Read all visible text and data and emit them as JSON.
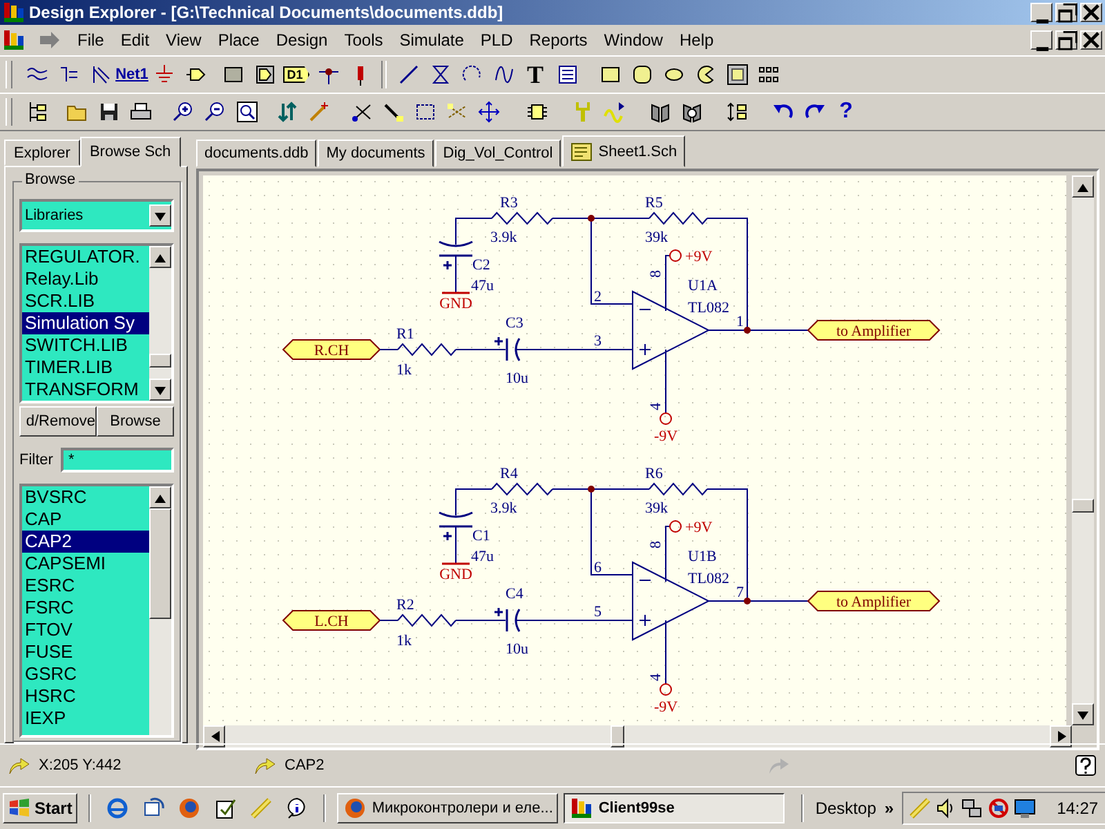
{
  "window": {
    "title": "Design Explorer - [G:\\Technical Documents\\documents.ddb]"
  },
  "menu": [
    {
      "label": "File"
    },
    {
      "label": "Edit"
    },
    {
      "label": "View"
    },
    {
      "label": "Place"
    },
    {
      "label": "Design"
    },
    {
      "label": "Tools"
    },
    {
      "label": "Simulate"
    },
    {
      "label": "PLD"
    },
    {
      "label": "Reports"
    },
    {
      "label": "Window"
    },
    {
      "label": "Help"
    }
  ],
  "toolbar_texts": {
    "net_label": "Net1",
    "part_port": "D1",
    "text_tool": "T",
    "help": "?"
  },
  "panel": {
    "tabs": [
      {
        "label": "Explorer",
        "selected": false
      },
      {
        "label": "Browse Sch",
        "selected": true
      }
    ],
    "group_title": "Browse",
    "browse_type": "Libraries",
    "libraries": [
      {
        "label": "REGULATOR.",
        "selected": false
      },
      {
        "label": "Relay.Lib",
        "selected": false
      },
      {
        "label": "SCR.LIB",
        "selected": false
      },
      {
        "label": "Simulation Sy",
        "selected": true
      },
      {
        "label": "SWITCH.LIB",
        "selected": false
      },
      {
        "label": "TIMER.LIB",
        "selected": false
      },
      {
        "label": "TRANSFORM",
        "selected": false
      }
    ],
    "buttons": [
      "d/Remove",
      "Browse"
    ],
    "filter_label": "Filter",
    "filter_value": "*",
    "components": [
      {
        "label": "BVSRC",
        "selected": false
      },
      {
        "label": "CAP",
        "selected": false
      },
      {
        "label": "CAP2",
        "selected": true
      },
      {
        "label": "CAPSEMI",
        "selected": false
      },
      {
        "label": "ESRC",
        "selected": false
      },
      {
        "label": "FSRC",
        "selected": false
      },
      {
        "label": "FTOV",
        "selected": false
      },
      {
        "label": "FUSE",
        "selected": false
      },
      {
        "label": "GSRC",
        "selected": false
      },
      {
        "label": "HSRC",
        "selected": false
      },
      {
        "label": "IEXP",
        "selected": false
      }
    ]
  },
  "documents": {
    "tabs": [
      {
        "label": "documents.ddb",
        "selected": false
      },
      {
        "label": "My documents",
        "selected": false
      },
      {
        "label": "Dig_Vol_Control",
        "selected": false
      },
      {
        "label": "Sheet1.Sch",
        "selected": true
      }
    ]
  },
  "schematic": {
    "stages": [
      {
        "input_port": "R.CH",
        "input_resistor": {
          "ref": "R1",
          "value": "1k"
        },
        "input_cap": {
          "ref": "C3",
          "value": "10u"
        },
        "gain_resistor": {
          "ref": "R3",
          "value": "3.9k"
        },
        "feedback_resistor": {
          "ref": "R5",
          "value": "39k"
        },
        "bypass_cap": {
          "ref": "C2",
          "value": "47u"
        },
        "ground": "GND",
        "opamp": {
          "ref": "U1A",
          "part": "TL082",
          "pin_inverting": "2",
          "pin_noninverting": "3",
          "pin_output": "1",
          "pin_vplus": "8",
          "pin_vminus": "4"
        },
        "supply_pos": "+9V",
        "supply_neg": "-9V",
        "output_port": "to Amplifier"
      },
      {
        "input_port": "L.CH",
        "input_resistor": {
          "ref": "R2",
          "value": "1k"
        },
        "input_cap": {
          "ref": "C4",
          "value": "10u"
        },
        "gain_resistor": {
          "ref": "R4",
          "value": "3.9k"
        },
        "feedback_resistor": {
          "ref": "R6",
          "value": "39k"
        },
        "bypass_cap": {
          "ref": "C1",
          "value": "47u"
        },
        "ground": "GND",
        "opamp": {
          "ref": "U1B",
          "part": "TL082",
          "pin_inverting": "6",
          "pin_noninverting": "5",
          "pin_output": "7",
          "pin_vplus": "8",
          "pin_vminus": "4"
        },
        "supply_pos": "+9V",
        "supply_neg": "-9V",
        "output_port": "to Amplifier"
      }
    ]
  },
  "status_bar": {
    "position": "X:205 Y:442",
    "component": "CAP2"
  },
  "taskbar": {
    "start": "Start",
    "tasks": [
      {
        "label": "Микроконтролери и еле...",
        "selected": false
      },
      {
        "label": "Client99se",
        "selected": true
      }
    ],
    "toolbar": "Desktop",
    "chevron": "»",
    "clock": "14:27"
  }
}
